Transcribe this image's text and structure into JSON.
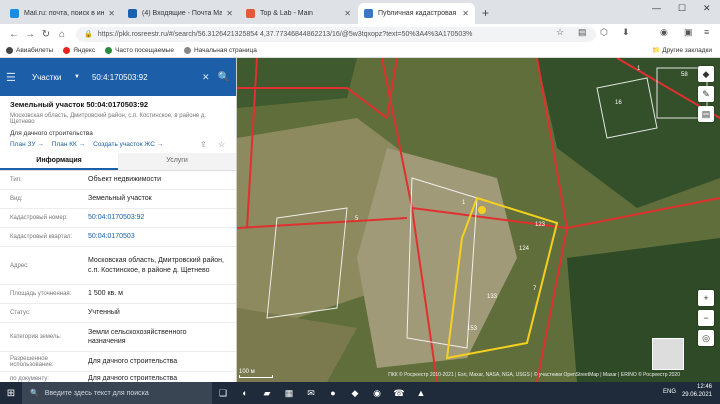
{
  "browser": {
    "tabs": [
      {
        "title": "Mail.ru: почта, поиск в интерн",
        "color": "#168de2"
      },
      {
        "title": "(4) Входящие - Почта Mail.ru",
        "color": "#1b5fb0"
      },
      {
        "title": "Top & Lab - Main",
        "color": "#e8563b"
      },
      {
        "title": "Публичная кадастровая карта",
        "color": "#3a76c4"
      }
    ],
    "url": "https://pkk.rosreestr.ru/#/search/56.3126421325854 4,37.77346844862213/16/@5w3tqxopz?text=50%3A4%3A170503%",
    "bookmarks": [
      "Авиабилеты",
      "Яндекс",
      "Часто посещаемые",
      "Начальная страница"
    ],
    "other_bookmarks": "Другие закладки"
  },
  "search": {
    "layer": "Участки",
    "query": "50:4:170503:92"
  },
  "object": {
    "title": "Земельный участок 50:04:0170503:92",
    "address_short": "Московская область, Дмитровский район, с.п. Костинское, в районе д. Щетнево",
    "use": "Для дачного строительства",
    "links": [
      "План ЗУ →",
      "План КК →",
      "Создать участок ЖС →"
    ]
  },
  "tabs": [
    "Информация",
    "Услуги"
  ],
  "info_rows": [
    {
      "k": "Тип:",
      "v": "Объект недвижимости",
      "link": false
    },
    {
      "k": "Вид:",
      "v": "Земельный участок",
      "link": false
    },
    {
      "k": "Кадастровый номер:",
      "v": "50:04:0170503:92",
      "link": true
    },
    {
      "k": "Кадастровый квартал:",
      "v": "50:04:0170503",
      "link": true
    },
    {
      "k": "Адрес:",
      "v": "Московская область, Дмитровский район, с.п. Костинское, в районе д. Щетнево",
      "link": false
    },
    {
      "k": "Площадь уточненная:",
      "v": "1 500 кв. м",
      "link": false
    },
    {
      "k": "Статус:",
      "v": "Учтенный",
      "link": false
    },
    {
      "k": "Категория земель:",
      "v": "Земли сельскохозяйственного назначения",
      "link": false
    },
    {
      "k": "Разрешенное использование:",
      "v": "Для дачного строительства",
      "link": false
    },
    {
      "k": "по документу:",
      "v": "Для дачного строительства",
      "link": false
    }
  ],
  "map": {
    "scale": "100 м",
    "copyright": "ПКК © Росреестр 2010-2021 | Esri, Maxar, NASA, NGA, USGS | © участники OpenStreetMap | Maxar | ERINO © Росреестр 2020",
    "parcel_labels": [
      "5",
      "1",
      "7",
      "123",
      "124",
      "153",
      "133",
      "58",
      "16",
      "1"
    ]
  },
  "taskbar": {
    "search": "Введите здесь текст для поиска",
    "lang": "ENG",
    "time": "12:46",
    "date": "29.06.2021"
  }
}
